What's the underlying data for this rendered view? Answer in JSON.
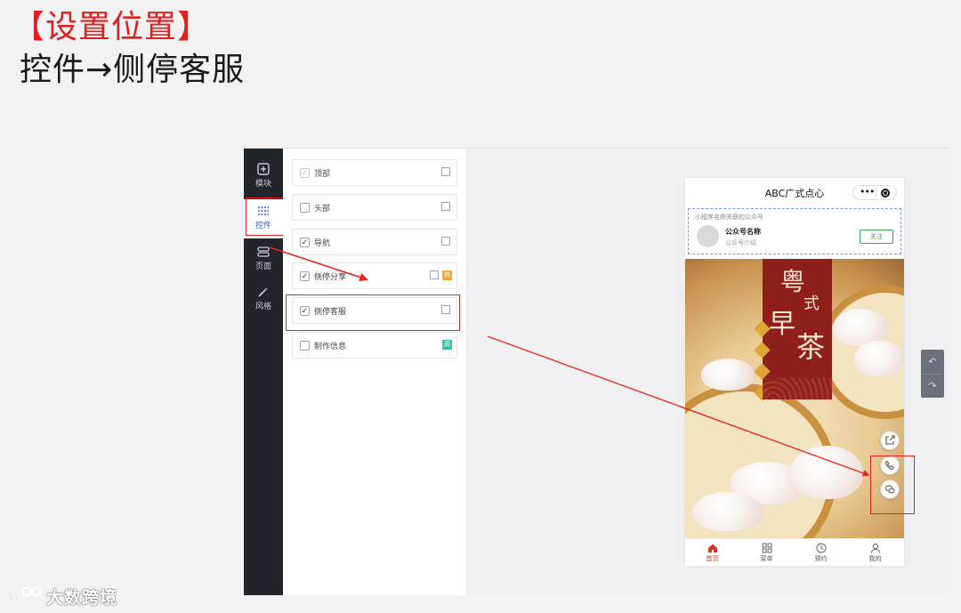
{
  "header": {
    "title": "【设置位置】",
    "subtitle": "控件→侧停客服"
  },
  "colors": {
    "accent_red": "#e02020",
    "highlight_box": "#e8231f",
    "rail_bg": "#22252b",
    "rail_active_text": "#2d5cdb",
    "follow_green": "#3aa64b",
    "tab_active": "#d13a2b"
  },
  "rail": {
    "items": [
      {
        "label": "模块",
        "icon": "plus-square-icon"
      },
      {
        "label": "控件",
        "icon": "sliders-icon",
        "active": true
      },
      {
        "label": "页面",
        "icon": "layers-icon"
      },
      {
        "label": "风格",
        "icon": "magic-wand-icon"
      }
    ]
  },
  "controls": {
    "rows": [
      {
        "label": "顶部",
        "checked": true,
        "disabled": true
      },
      {
        "label": "头部",
        "checked": false
      },
      {
        "label": "导航",
        "checked": true
      },
      {
        "label": "侧停分享",
        "checked": true,
        "tag": "热"
      },
      {
        "label": "侧停客服",
        "checked": true
      },
      {
        "label": "制作信息",
        "checked": false,
        "tag": "高"
      }
    ]
  },
  "phone": {
    "title": "ABC广式点心",
    "capsule_dots": "•••",
    "oa_card": {
      "hint": "小程序名称关联的公众号",
      "name": "公众号名称",
      "intro": "公众号介绍",
      "follow": "关注"
    },
    "poster": {
      "char1": "粤",
      "char2": "式",
      "char3": "早",
      "char4": "茶",
      "tags": [
        "传",
        "统",
        "美",
        "食"
      ]
    },
    "float_buttons": [
      "share-icon",
      "phone-icon",
      "chat-icon"
    ],
    "tabbar": [
      {
        "label": "首页",
        "icon": "home-icon",
        "active": true
      },
      {
        "label": "菜单",
        "icon": "grid-icon"
      },
      {
        "label": "预约",
        "icon": "clock-icon"
      },
      {
        "label": "我的",
        "icon": "user-icon"
      }
    ]
  },
  "side_tools": {
    "undo": "↶",
    "redo": "↷"
  },
  "watermark": {
    "text": "大数跨境"
  }
}
